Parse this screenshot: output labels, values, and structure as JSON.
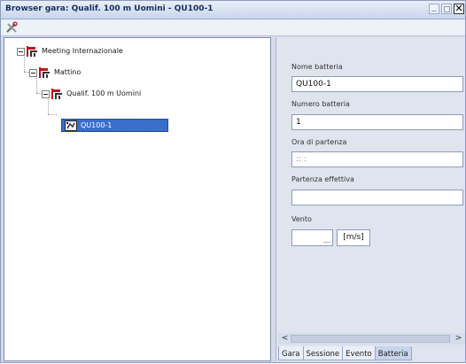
{
  "window": {
    "title": "Browser gara: Qualif. 100 m Uomini - QU100-1",
    "close_glyph": "✕"
  },
  "toolbar": {
    "tools_icon": "tools-icon"
  },
  "tree": {
    "meeting": "Meeting Internazionale",
    "session": "Mattino",
    "event": "Qualif. 100 m Uomini",
    "heat": "QU100-1"
  },
  "form": {
    "nome_batteria_label": "Nome batteria",
    "nome_batteria_value": "QU100-1",
    "numero_batteria_label": "Numero batteria",
    "numero_batteria_value": "1",
    "ora_partenza_label": "Ora di partenza",
    "ora_partenza_value": ":: :",
    "partenza_effettiva_label": "Partenza effettiva",
    "partenza_effettiva_value": "",
    "vento_label": "Vento",
    "vento_value": "",
    "vento_unit": "[m/s]"
  },
  "scroll": {
    "left": "<",
    "right": ">"
  },
  "tabs": [
    "Gara",
    "Sessione",
    "Evento",
    "Batteria"
  ],
  "active_tab": "Batteria",
  "colors": {
    "selection": "#3a6ecb",
    "flag_red": "#c0141a"
  }
}
